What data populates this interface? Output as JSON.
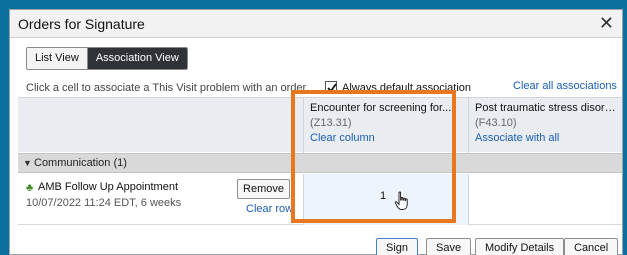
{
  "dialog": {
    "title": "Orders for Signature",
    "close_glyph": "✕"
  },
  "view_tabs": {
    "list_view": "List View",
    "association_view": "Association View",
    "selected": "Association View"
  },
  "hint_text": "Click a cell to associate a This Visit problem with an order.",
  "default_association": {
    "label": "Always default association",
    "checked": true
  },
  "clear_all_label": "Clear all associations",
  "problems": [
    {
      "title": "Encounter for screening for...",
      "code": "(Z13.31)",
      "action": "Clear column"
    },
    {
      "title": "Post traumatic stress disord...",
      "code": "(F43.10)",
      "action": "Associate with all"
    }
  ],
  "section": {
    "label": "Communication (1)",
    "expanded": true
  },
  "order": {
    "icon": "order-status-icon",
    "name": "AMB Follow Up Appointment",
    "meta": "10/07/2022 11:24 EDT, 6 weeks",
    "remove_label": "Remove",
    "clear_row_label": "Clear row",
    "association_number": "1"
  },
  "footer": {
    "sign_label": "Sign",
    "save_label": "Save",
    "modify_label": "Modify Details",
    "cancel_label": "Cancel"
  },
  "colors": {
    "highlight": "#e87722",
    "link": "#1a5fb4",
    "frame": "#0d6f9e",
    "selected_tab": "#2f3237"
  }
}
